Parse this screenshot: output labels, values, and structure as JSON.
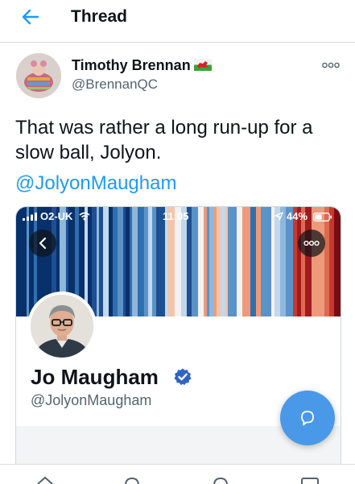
{
  "header": {
    "title": "Thread",
    "back_icon": "back-arrow-icon",
    "accent_color": "#1d9bf0"
  },
  "tweet": {
    "author_name": "Timothy Brennan",
    "author_flag_icon": "welsh-flag-icon",
    "author_handle": "@BrennanQC",
    "text": "That was rather a long run-up for a slow ball, Jolyon.",
    "mention": "@JolyonMaugham",
    "more_icon": "more-horizontal-icon"
  },
  "embedded_screenshot": {
    "status_bar": {
      "carrier": "O2-UK",
      "time": "11:05",
      "battery": "44%"
    },
    "banner": "warming-stripes-banner",
    "profile": {
      "name": "Jo Maugham",
      "handle": "@JolyonMaugham",
      "verified": true,
      "verified_color": "#1d9bf0"
    }
  },
  "compose_button": {
    "icon": "reply-bubble-icon",
    "color": "#4a99e9"
  },
  "tabbar": {
    "icons": [
      "home-icon",
      "search-icon",
      "spaces-icon",
      "messages-icon"
    ]
  }
}
